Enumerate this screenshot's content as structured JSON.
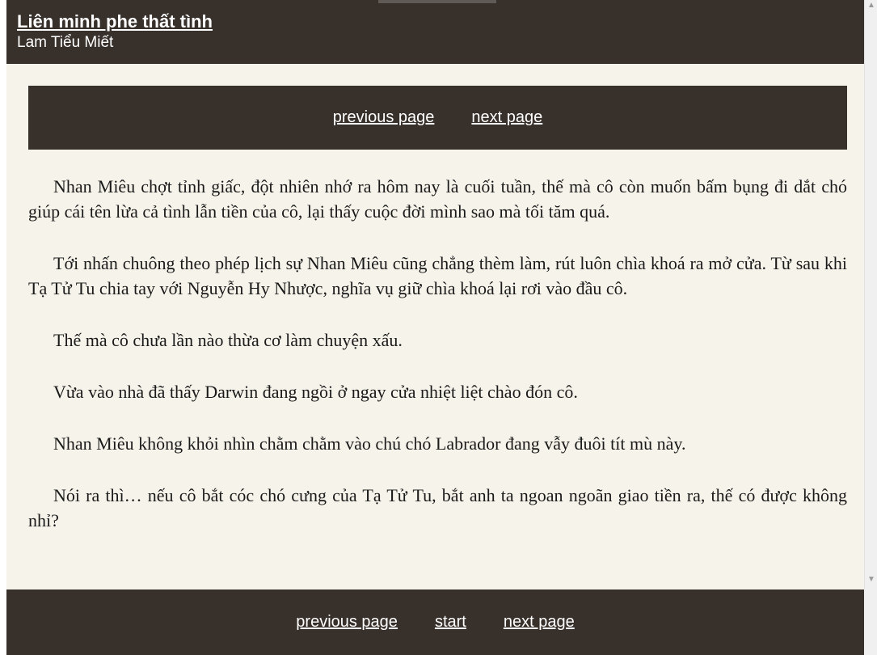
{
  "header": {
    "title": "Liên minh phe thất tình",
    "author": "Lam Tiểu Miết"
  },
  "nav_top": {
    "previous": "previous page",
    "next": "next page"
  },
  "paragraphs": [
    "Nhan Miêu chợt tỉnh giấc, đột nhiên nhớ ra hôm nay là cuối tuần, thế mà cô còn muốn bấm bụng đi dắt chó giúp cái tên lừa cả tình lẫn tiền của cô, lại thấy cuộc đời mình sao mà tối tăm quá.",
    "Tới nhấn chuông theo phép lịch sự Nhan Miêu cũng chẳng thèm làm, rút luôn chìa khoá ra mở cửa. Từ sau khi Tạ Tử Tu chia tay với Nguyễn Hy Nhược, nghĩa vụ giữ chìa khoá lại rơi vào đầu cô.",
    "Thế mà cô chưa lần nào thừa cơ làm chuyện xấu.",
    "Vừa vào nhà đã thấy Darwin đang ngồi ở ngay cửa nhiệt liệt chào đón cô.",
    "Nhan Miêu không khỏi nhìn chằm chằm vào chú chó Labrador đang vẫy đuôi tít mù này.",
    "Nói ra thì… nếu cô bắt cóc chó cưng của Tạ Tử Tu, bắt anh ta ngoan ngoãn giao tiền ra, thế có được không nhỉ?"
  ],
  "nav_bottom": {
    "previous": "previous page",
    "start": "start",
    "next": "next page"
  },
  "colors": {
    "bar": "#38302b",
    "page": "#f6f4ea"
  }
}
